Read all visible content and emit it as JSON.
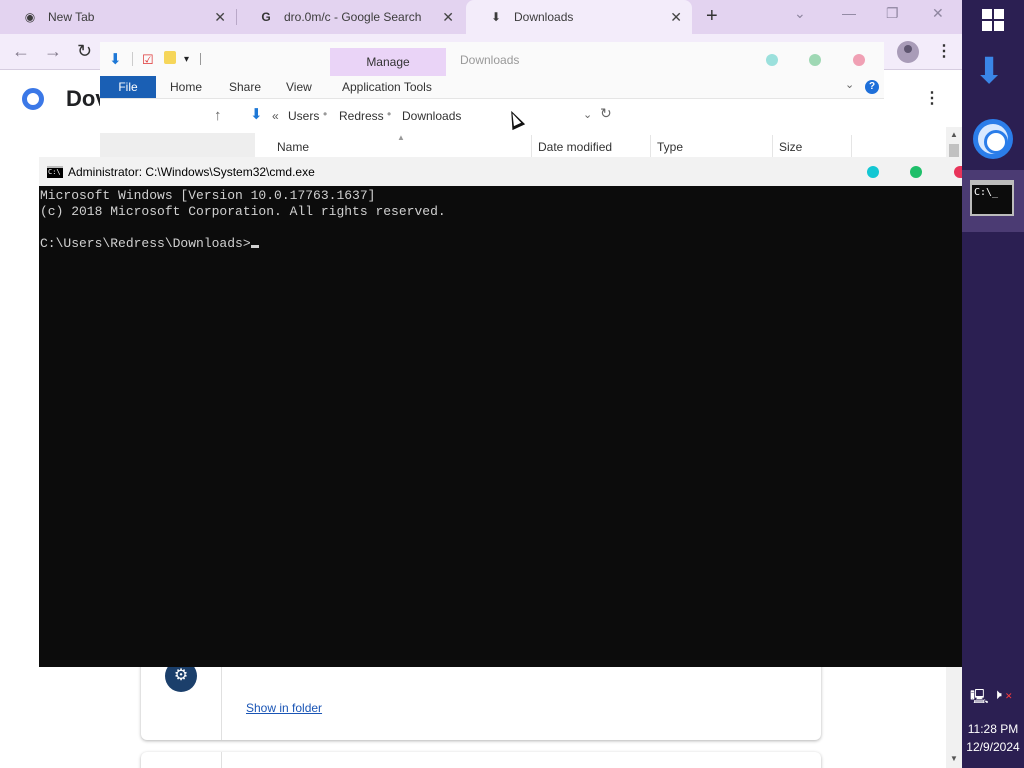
{
  "chrome": {
    "tabs": [
      {
        "title": "New Tab",
        "icon": "chrome-icon"
      },
      {
        "title": "dro.0m/c - Google Search",
        "icon": "google-icon"
      },
      {
        "title": "Downloads",
        "icon": "download-icon"
      }
    ],
    "page": {
      "title": "Dov",
      "show_in_folder": "Show in folder"
    }
  },
  "explorer": {
    "manage_label": "Manage",
    "window_title": "Downloads",
    "ribbon_tabs": [
      "File",
      "Home",
      "Share",
      "View",
      "Application Tools"
    ],
    "breadcrumb": [
      "Users",
      "Redress",
      "Downloads"
    ],
    "breadcrumb_prefix": "«",
    "columns": [
      "Name",
      "Date modified",
      "Type",
      "Size"
    ]
  },
  "cmd": {
    "title": "Administrator: C:\\Windows\\System32\\cmd.exe",
    "lines": [
      "Microsoft Windows [Version 10.0.17763.1637]",
      "(c) 2018 Microsoft Corporation. All rights reserved.",
      "",
      "C:\\Users\\Redress\\Downloads>"
    ]
  },
  "taskbar": {
    "cmd_icon_text": "C:\\_",
    "time": "11:28 PM",
    "date": "12/9/2024"
  },
  "colors": {
    "tabstrip": "#e3d3f0",
    "taskbar": "#2b1f52",
    "cmd_background": "#0c0c0c",
    "accent_blue": "#1a5fb4"
  }
}
